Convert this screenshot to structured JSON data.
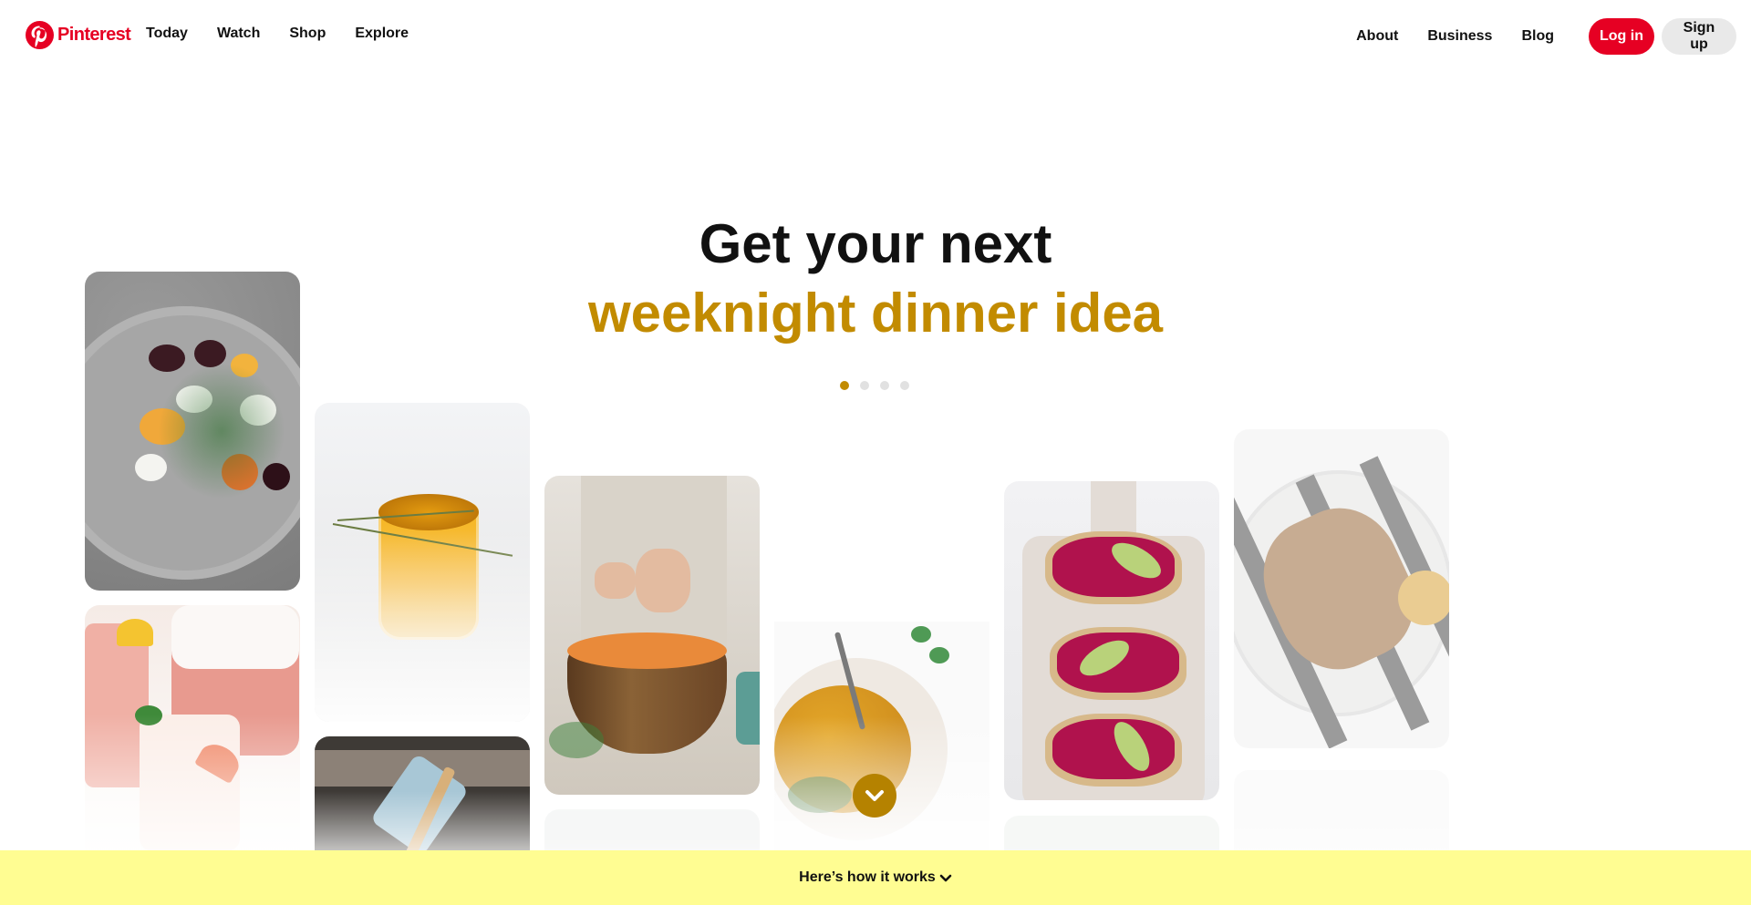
{
  "header": {
    "brand": "Pinterest",
    "nav_left": [
      "Today",
      "Watch",
      "Shop",
      "Explore"
    ],
    "nav_right": [
      "About",
      "Business",
      "Blog"
    ],
    "login_label": "Log in",
    "signup_label": "Sign up",
    "icons": {
      "logo": "pinterest-logo-icon"
    }
  },
  "hero": {
    "line1": "Get your next",
    "line2": "weeknight dinner idea",
    "accent_color": "#c28b00",
    "carousel": {
      "total": 4,
      "active_index": 0
    }
  },
  "pins": [
    {
      "subject": "beet salad with goat cheese"
    },
    {
      "subject": "orange drink with thyme"
    },
    {
      "subject": "carrots in wooden bowl"
    },
    {
      "subject": "hummus with spoon"
    },
    {
      "subject": "beet toast with avocado"
    },
    {
      "subject": "grilled chicken with lemon"
    },
    {
      "subject": "pink lemonade"
    },
    {
      "subject": "pan with oven mitt"
    }
  ],
  "scroll_button": {
    "icon": "chevron-down-icon"
  },
  "footer": {
    "label": "Here’s how it works",
    "icon": "chevron-down-icon",
    "background": "#fffd92"
  },
  "colors": {
    "brand_red": "#e60023",
    "signup_grey": "#e9e9e9"
  }
}
